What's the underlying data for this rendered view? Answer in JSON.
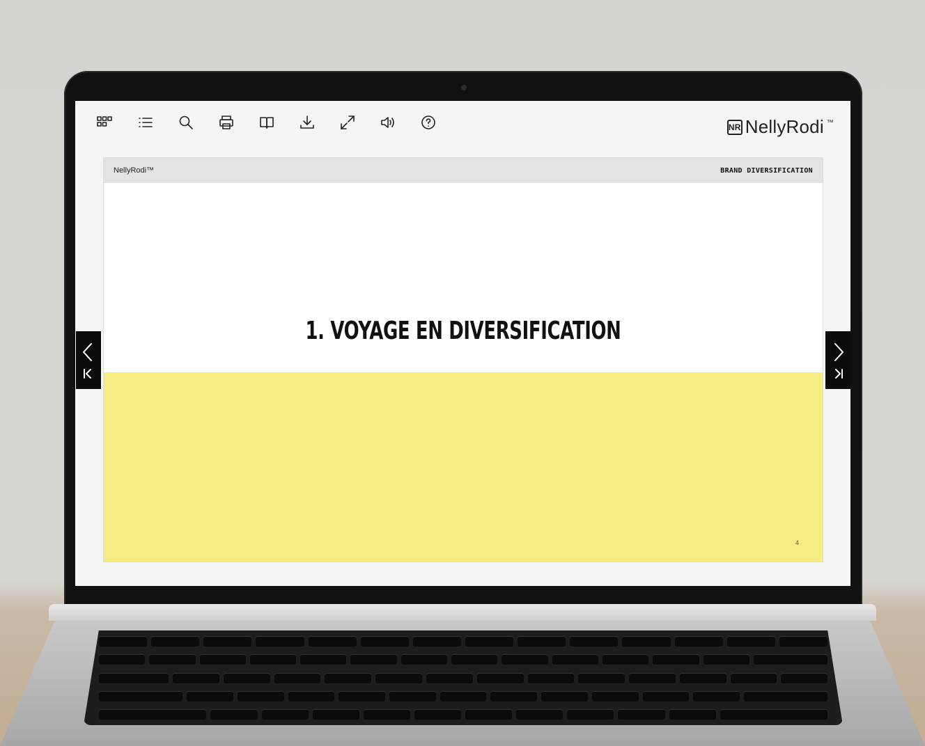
{
  "toolbar": {
    "items": [
      {
        "name": "thumbnails",
        "icon": "grid-icon"
      },
      {
        "name": "table-of-contents",
        "icon": "list-icon"
      },
      {
        "name": "search",
        "icon": "search-icon"
      },
      {
        "name": "print",
        "icon": "printer-icon"
      },
      {
        "name": "book-view",
        "icon": "book-icon"
      },
      {
        "name": "download",
        "icon": "download-icon"
      },
      {
        "name": "fullscreen",
        "icon": "expand-icon"
      },
      {
        "name": "sound",
        "icon": "speaker-icon"
      },
      {
        "name": "help",
        "icon": "help-icon"
      }
    ]
  },
  "logo": {
    "text": "NellyRodi",
    "trademark": "™",
    "mark": "NR"
  },
  "slide": {
    "header_brand": "NellyRodi™",
    "header_tag": "BRAND DIVERSIFICATION",
    "title": "1. VOYAGE EN DIVERSIFICATION",
    "page_number": "4",
    "accent_color": "#f6ec84"
  },
  "navigation": {
    "prev_icon": "chevron-left-icon",
    "first_icon": "first-page-icon",
    "next_icon": "chevron-right-icon",
    "last_icon": "last-page-icon"
  }
}
